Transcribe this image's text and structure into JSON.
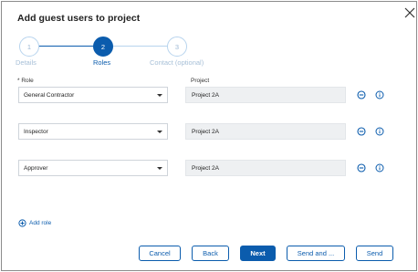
{
  "dialog": {
    "title": "Add guest users to project"
  },
  "stepper": {
    "steps": [
      {
        "number": "1",
        "label": "Details",
        "state": "done"
      },
      {
        "number": "2",
        "label": "Roles",
        "state": "active"
      },
      {
        "number": "3",
        "label": "Contact (optional)",
        "state": "todo"
      }
    ]
  },
  "form": {
    "role_header": "* Role",
    "project_header": "Project",
    "rows": [
      {
        "role": "General Contractor",
        "project": "Project 2A"
      },
      {
        "role": "Inspector",
        "project": "Project 2A"
      },
      {
        "role": "Approver",
        "project": "Project 2A"
      }
    ],
    "add_role_label": "Add role"
  },
  "footer": {
    "cancel_label": "Cancel",
    "back_label": "Back",
    "next_label": "Next",
    "send_and_label": "Send and ...",
    "send_label": "Send"
  },
  "colors": {
    "accent": "#0b5cad",
    "muted_step": "#a6bfd7",
    "project_bg": "#eef0f2"
  },
  "icons": {
    "close": "close-icon",
    "remove": "minus-circle-icon",
    "info": "info-icon",
    "caret": "chevron-down-icon",
    "add": "plus-circle-icon"
  }
}
